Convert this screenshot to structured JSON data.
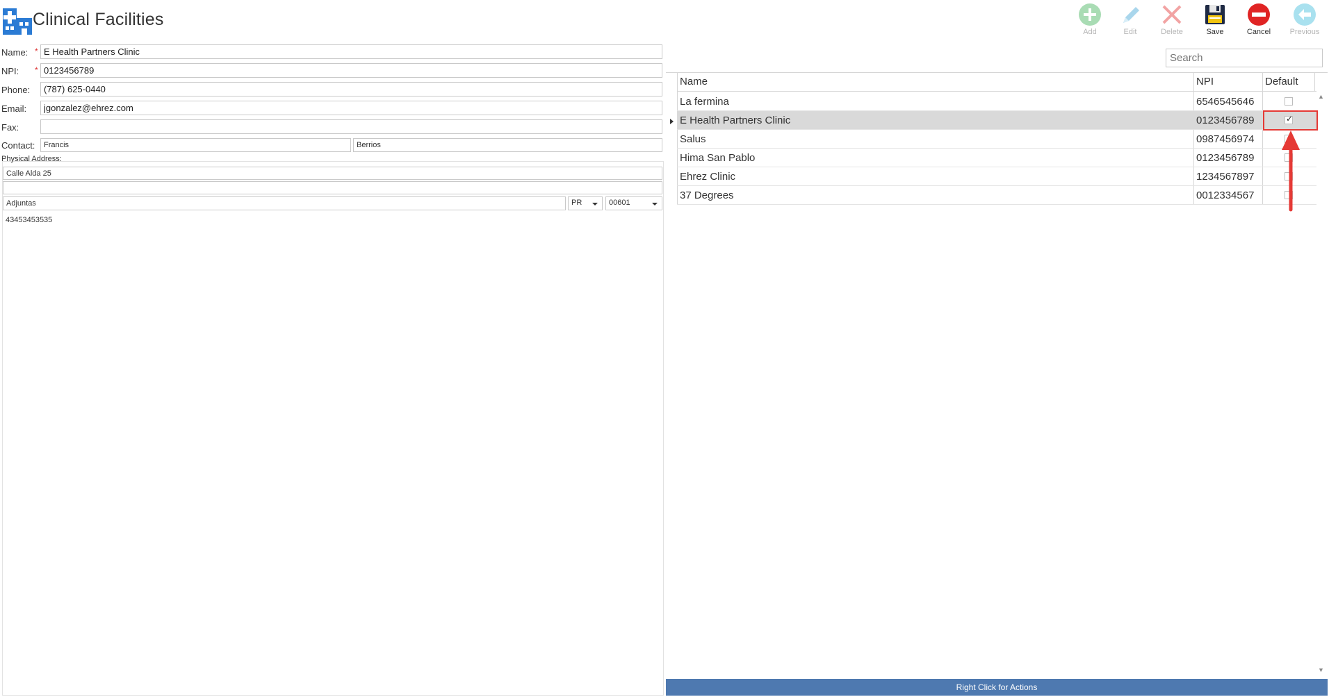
{
  "header": {
    "title": "Clinical Facilities"
  },
  "toolbar": [
    {
      "label": "Add",
      "icon": "add-icon",
      "enabled": false
    },
    {
      "label": "Edit",
      "icon": "edit-icon",
      "enabled": false
    },
    {
      "label": "Delete",
      "icon": "delete-icon",
      "enabled": false
    },
    {
      "label": "Save",
      "icon": "save-icon",
      "enabled": true
    },
    {
      "label": "Cancel",
      "icon": "cancel-icon",
      "enabled": true
    },
    {
      "label": "Previous",
      "icon": "previous-icon",
      "enabled": false
    }
  ],
  "form": {
    "name_label": "Name:",
    "name_value": "E Health Partners Clinic",
    "npi_label": "NPI:",
    "npi_value": "0123456789",
    "phone_label": "Phone:",
    "phone_value": "(787) 625-0440",
    "email_label": "Email:",
    "email_value": "jgonzalez@ehrez.com",
    "fax_label": "Fax:",
    "fax_value": "",
    "contact_label": "Contact:",
    "contact_first": "Francis",
    "contact_last": "Berrios",
    "address_label": "Physical Address:",
    "address_line1": "Calle Alda 25",
    "address_line2": "",
    "city": "Adjuntas",
    "state": "PR",
    "zip": "00601",
    "extra_number": "43453453535",
    "required_mark": "*"
  },
  "search": {
    "placeholder": "Search"
  },
  "grid": {
    "columns": [
      "Name",
      "NPI",
      "Default"
    ],
    "rows": [
      {
        "name": "La fermina",
        "npi": "6546545646",
        "default": false
      },
      {
        "name": "E Health Partners Clinic",
        "npi": "0123456789",
        "default": true
      },
      {
        "name": "Salus",
        "npi": "0987456974",
        "default": false
      },
      {
        "name": "Hima San Pablo",
        "npi": "0123456789",
        "default": false
      },
      {
        "name": "Ehrez  Clinic",
        "npi": "1234567897",
        "default": false
      },
      {
        "name": "37 Degrees",
        "npi": "0012334567",
        "default": false
      }
    ],
    "selected_index": 1
  },
  "status_bar": {
    "text": "Right Click for Actions"
  },
  "colors": {
    "accent": "#4e79b0",
    "annotation": "#e53935",
    "required": "#dd3333"
  }
}
